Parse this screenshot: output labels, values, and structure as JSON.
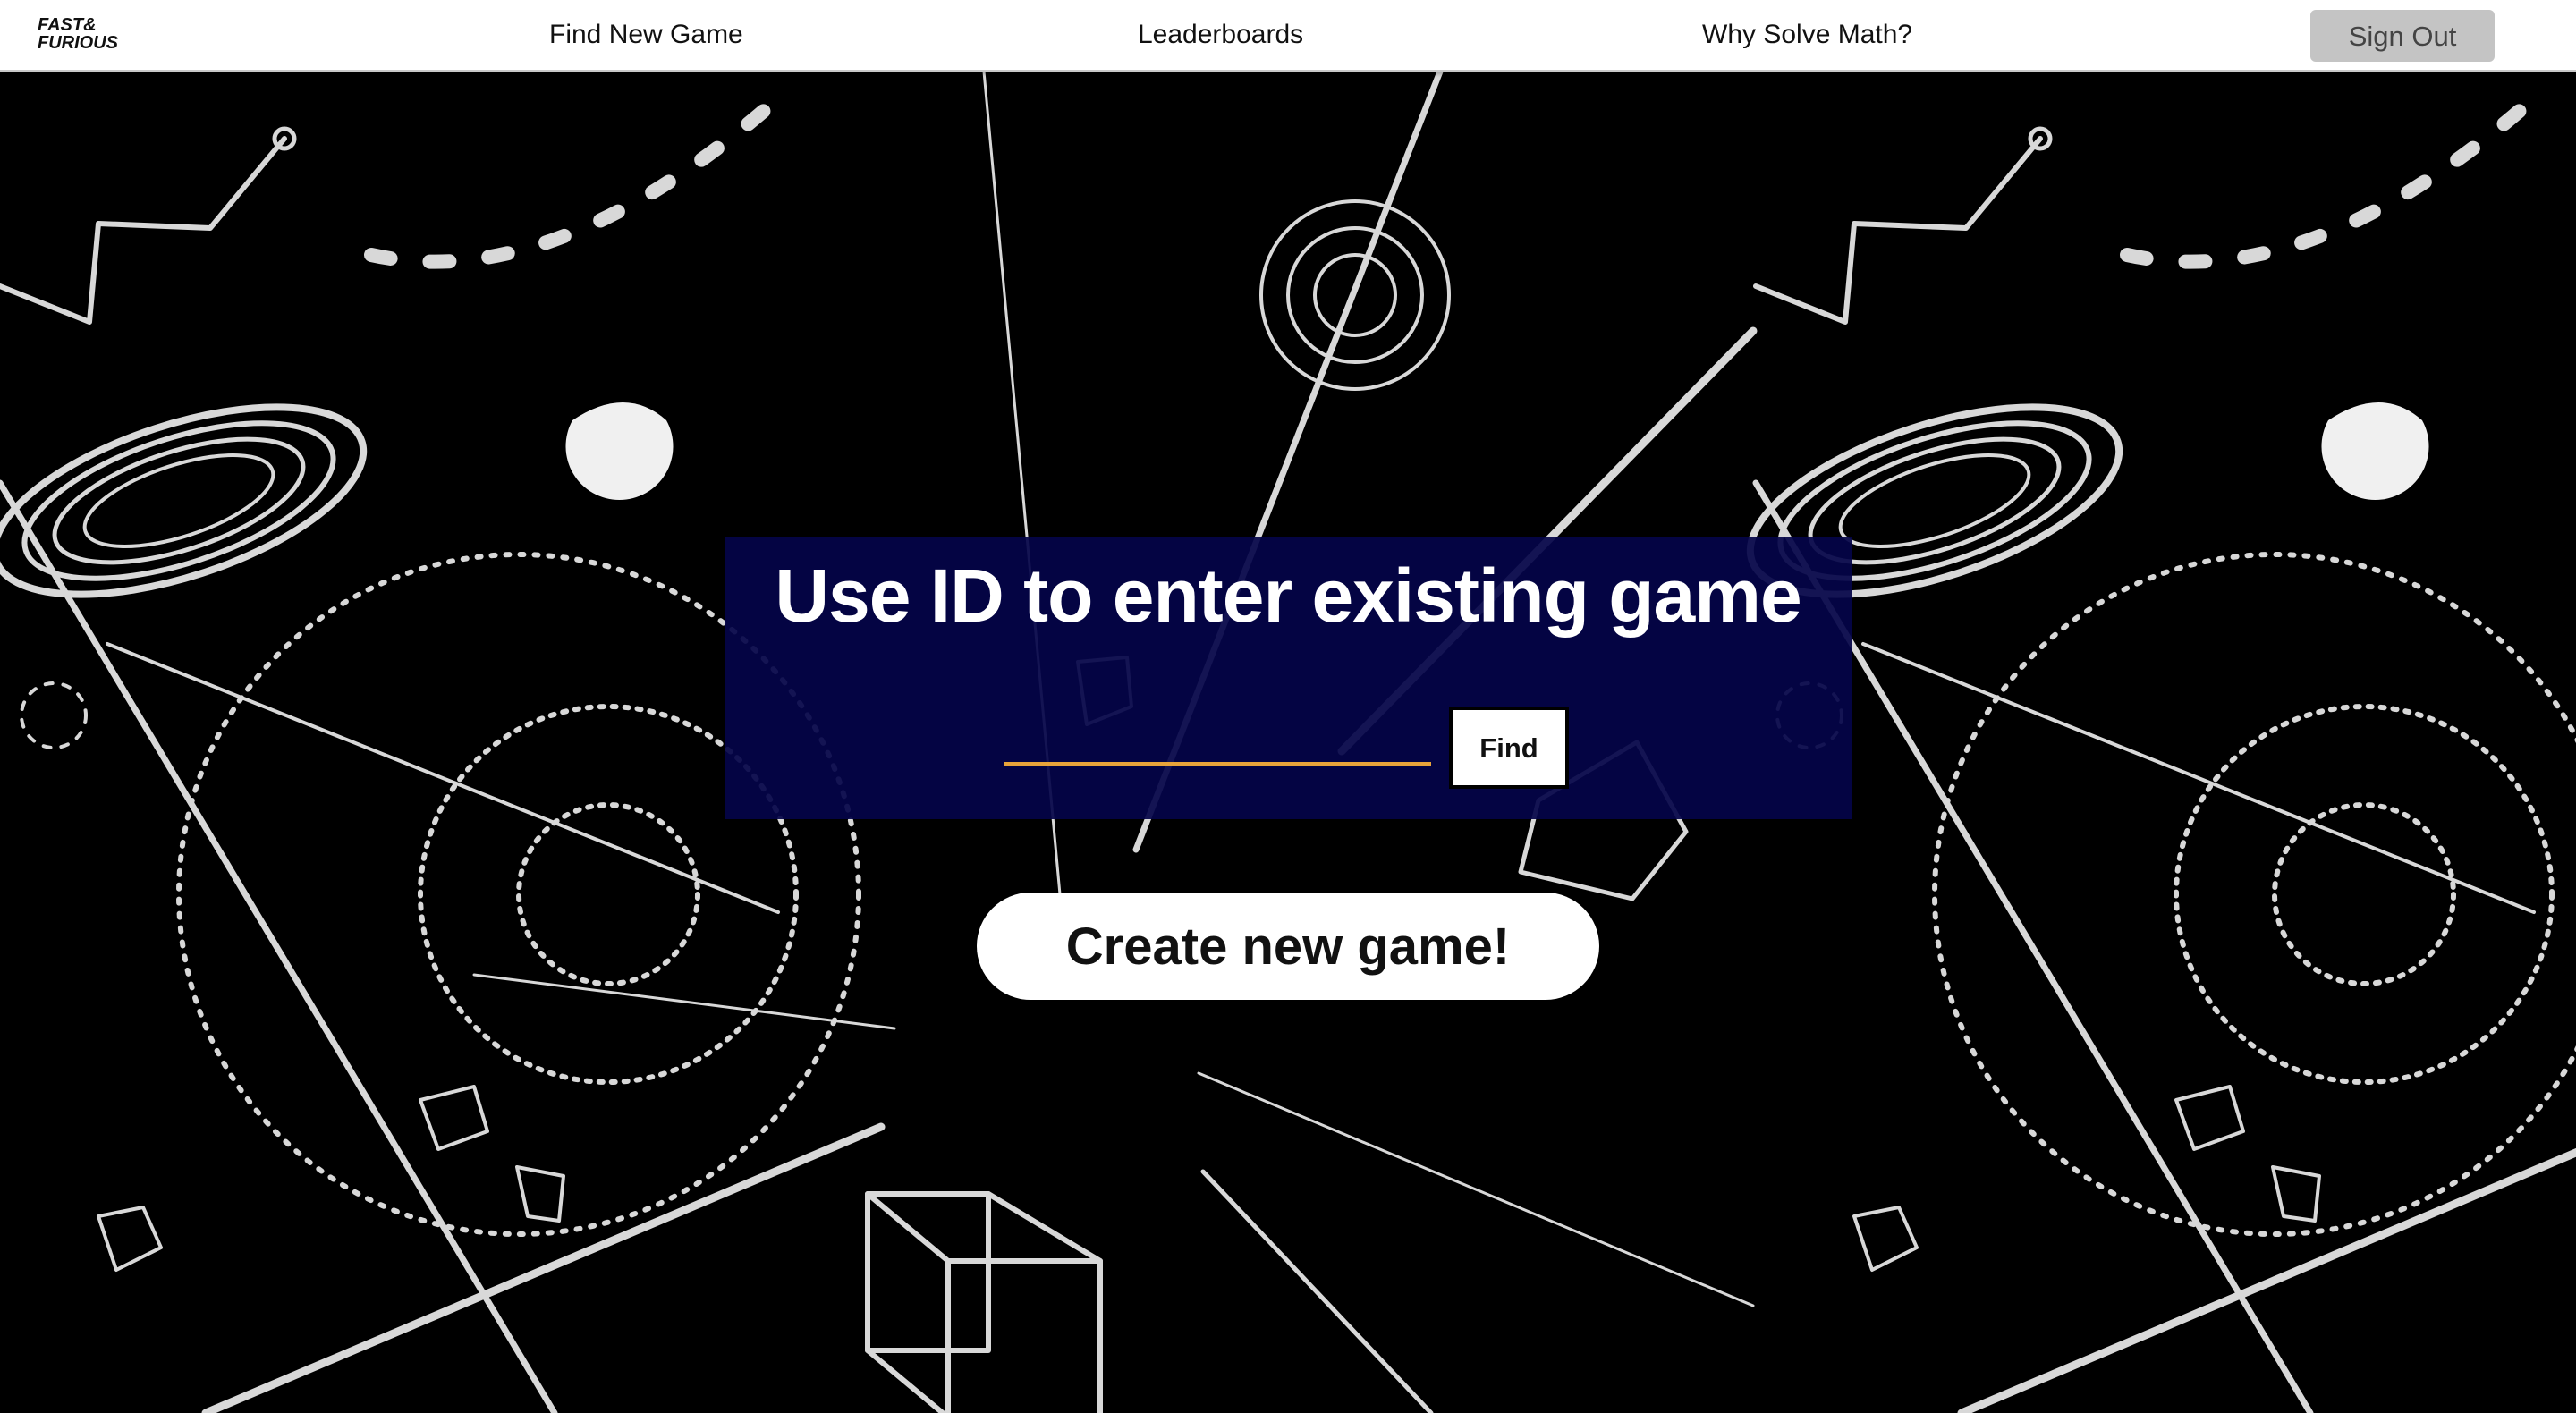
{
  "nav": {
    "logo_line1": "FAST&",
    "logo_line2": "FURIOUS",
    "links": [
      "Find New Game",
      "Leaderboards",
      "Why Solve Math?"
    ],
    "sign_out_label": "Sign Out"
  },
  "main": {
    "panel_title": "Use ID to enter existing game",
    "id_input_value": "",
    "find_label": "Find",
    "create_label": "Create new game!"
  },
  "colors": {
    "panel_bg": "#04044a",
    "input_underline": "#e8a43a",
    "nav_bg": "#ffffff",
    "signout_bg": "#c4c4c4",
    "background": "#000000"
  }
}
